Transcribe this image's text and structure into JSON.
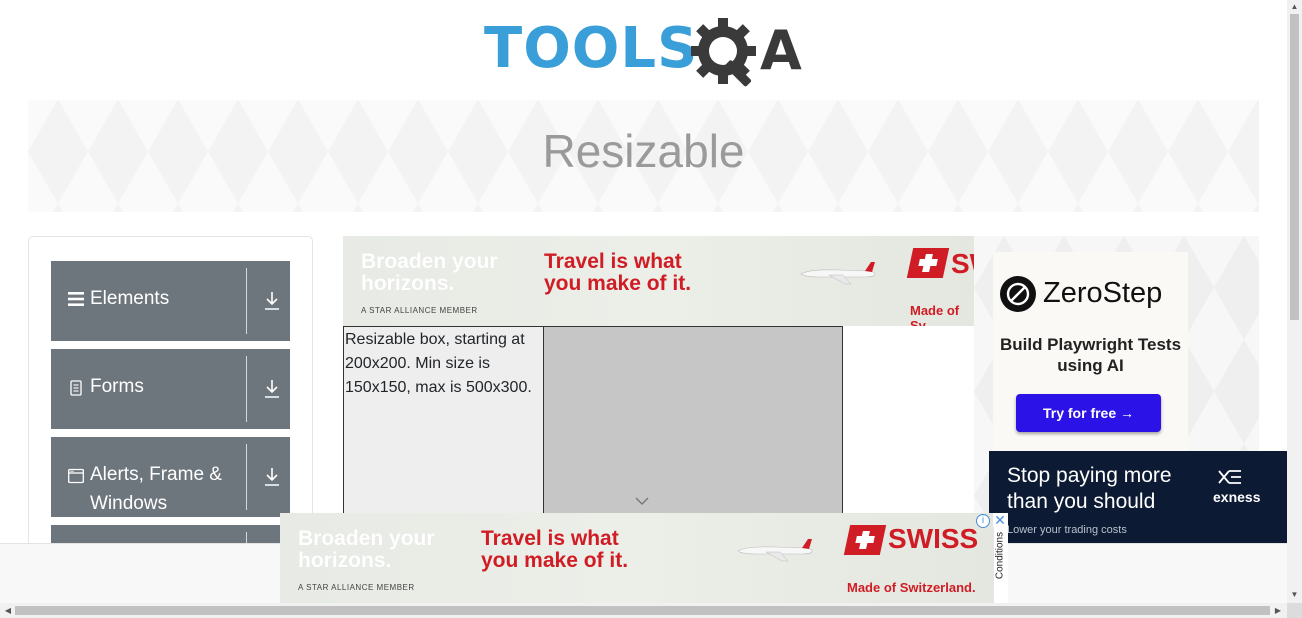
{
  "header": {
    "logo_text_left": "TOOLS",
    "logo_text_right": "A"
  },
  "page": {
    "title": "Resizable"
  },
  "sidebar": {
    "groups": [
      {
        "label": "Elements",
        "icon": "menu-icon"
      },
      {
        "label": "Forms",
        "icon": "document-icon"
      },
      {
        "label": "Alerts, Frame &",
        "label_line2": "Windows",
        "icon": "window-icon"
      }
    ]
  },
  "ad_top": {
    "headline_white_1": "Broaden your",
    "headline_white_2": "horizons.",
    "headline_red_1": "Travel is what",
    "headline_red_2": "you make of it.",
    "alliance": "A STAR ALLIANCE MEMBER",
    "brand": "SW",
    "tagline": "Made of Sv"
  },
  "resizable": {
    "text": "Resizable box, starting at 200x200. Min size is 150x150, max is 500x300."
  },
  "zerostep": {
    "name": "ZeroStep",
    "tagline": "Build Playwright Tests using AI",
    "button": "Try for free →"
  },
  "exness": {
    "headline_1": "Stop paying more",
    "headline_2": "than you should",
    "subline": "Lower your trading costs",
    "logo": "exness"
  },
  "ad_bottom": {
    "headline_white_1": "Broaden your",
    "headline_white_2": "horizons.",
    "headline_red_1": "Travel is what",
    "headline_red_2": "you make of it.",
    "alliance": "A STAR ALLIANCE MEMBER",
    "brand": "SWISS",
    "tagline": "Made of Switzerland.",
    "info": "i",
    "close": "✕",
    "conditions": "Conditions"
  },
  "colors": {
    "accent_blue": "#3a9fd8",
    "sidebar_group": "#6d757d",
    "swiss_red": "#d01c24",
    "zerostep_button": "#2b12e6"
  }
}
